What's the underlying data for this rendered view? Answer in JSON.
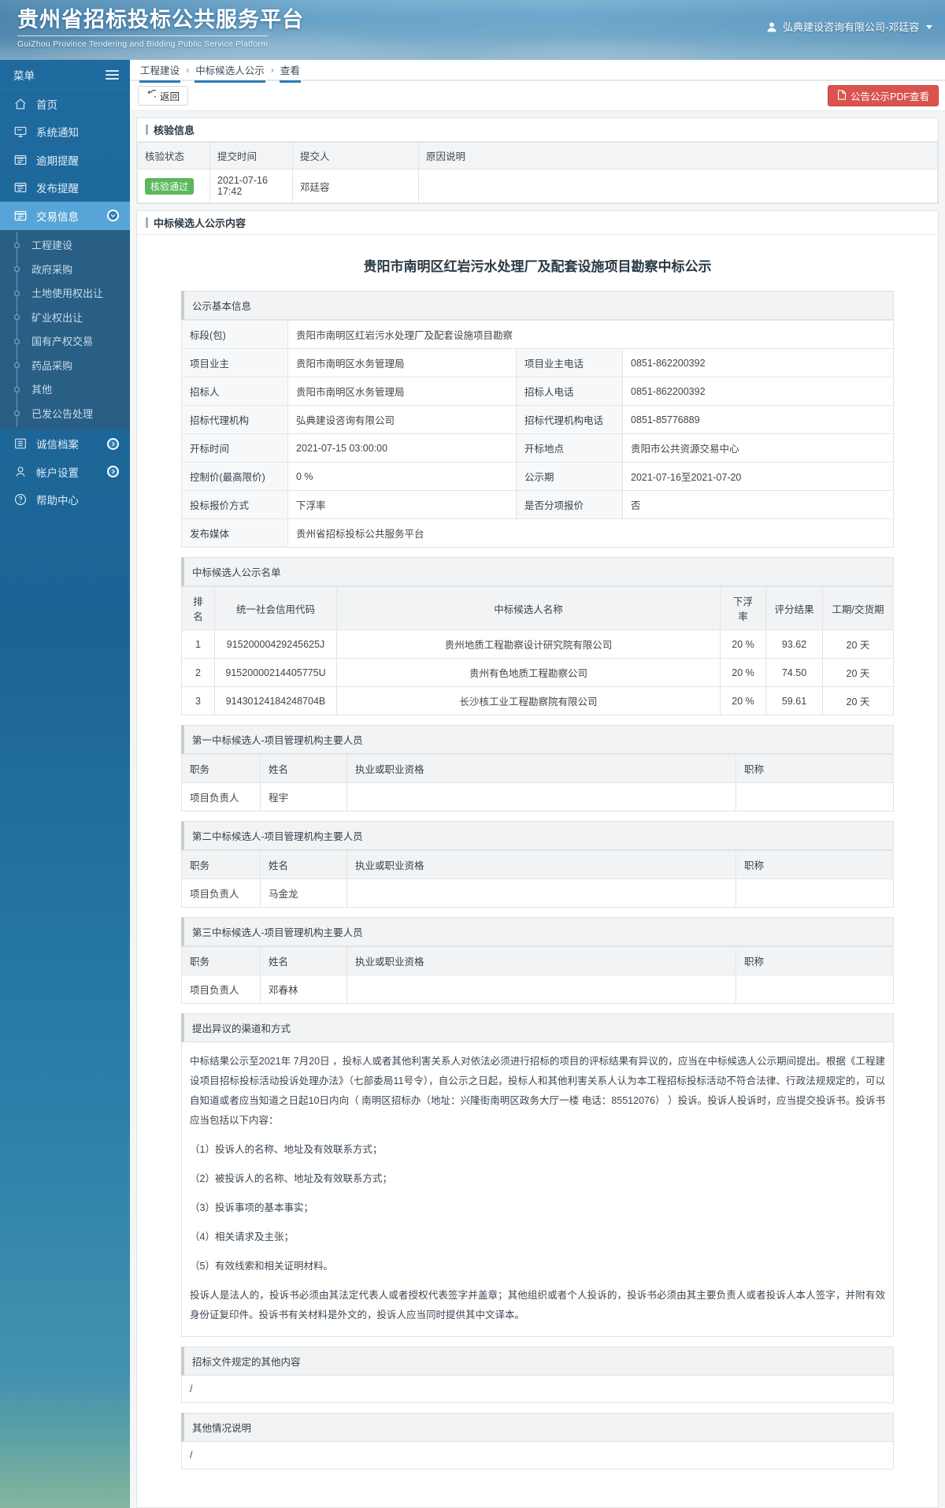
{
  "header": {
    "title_cn": "贵州省招标投标公共服务平台",
    "title_en": "GuiZhou Province Tendering and Bidding Public Service Platform",
    "user": "弘典建设咨询有限公司-邓廷容"
  },
  "sidebar": {
    "menu_label": "菜单",
    "items": [
      {
        "label": "首页",
        "icon": "home-icon",
        "active": false,
        "badge": ""
      },
      {
        "label": "系统通知",
        "icon": "monitor-icon",
        "active": false,
        "badge": ""
      },
      {
        "label": "逾期提醒",
        "icon": "list-box-icon",
        "active": false,
        "badge": ""
      },
      {
        "label": "发布提醒",
        "icon": "list-box-icon",
        "active": false,
        "badge": ""
      },
      {
        "label": "交易信息",
        "icon": "list-box-icon",
        "active": true,
        "badge": "chevron-down-icon"
      },
      {
        "label": "诚信档案",
        "icon": "list-lines-icon",
        "active": false,
        "badge": "chevron-right-icon"
      },
      {
        "label": "帐户设置",
        "icon": "user-icon",
        "active": false,
        "badge": "chevron-right-icon"
      },
      {
        "label": "帮助中心",
        "icon": "question-icon",
        "active": false,
        "badge": ""
      }
    ],
    "submenu": [
      "工程建设",
      "政府采购",
      "土地使用权出让",
      "矿业权出让",
      "国有产权交易",
      "药品采购",
      "其他",
      "已发公告处理"
    ]
  },
  "breadcrumb": {
    "items": [
      "工程建设",
      "中标候选人公示",
      "查看"
    ],
    "separator": "›"
  },
  "toolbar": {
    "back_label": "返回",
    "pdf_label": "公告公示PDF查看"
  },
  "verify_panel": {
    "title": "核验信息",
    "columns": [
      "核验状态",
      "提交时间",
      "提交人",
      "原因说明"
    ],
    "row": {
      "status": "核验通过",
      "submit_time": "2021-07-16 17:42",
      "submitter": "邓廷容",
      "reason": ""
    }
  },
  "content_panel": {
    "title": "中标候选人公示内容"
  },
  "doc": {
    "title": "贵阳市南明区红岩污水处理厂及配套设施项目勘察中标公示",
    "basic_info": {
      "section_title": "公示基本信息",
      "rows": [
        {
          "k": "标段(包)",
          "v": "贵阳市南明区红岩污水处理厂及配套设施项目勘察",
          "full": true
        },
        {
          "k": "项目业主",
          "v": "贵阳市南明区水务管理局",
          "k2": "项目业主电话",
          "v2": "0851-862200392"
        },
        {
          "k": "招标人",
          "v": "贵阳市南明区水务管理局",
          "k2": "招标人电话",
          "v2": "0851-862200392"
        },
        {
          "k": "招标代理机构",
          "v": "弘典建设咨询有限公司",
          "k2": "招标代理机构电话",
          "v2": "0851-85776889"
        },
        {
          "k": "开标时间",
          "v": "2021-07-15 03:00:00",
          "k2": "开标地点",
          "v2": "贵阳市公共资源交易中心"
        },
        {
          "k": "控制价(最高限价)",
          "v": "0 %",
          "k2": "公示期",
          "v2": "2021-07-16至2021-07-20"
        },
        {
          "k": "投标报价方式",
          "v": "下浮率",
          "k2": "是否分项报价",
          "v2": "否"
        },
        {
          "k": "发布媒体",
          "v": "贵州省招标投标公共服务平台",
          "full": true
        }
      ]
    },
    "candidates": {
      "section_title": "中标候选人公示名单",
      "columns": [
        "排名",
        "统一社会信用代码",
        "中标候选人名称",
        "下浮率",
        "评分结果",
        "工期/交货期"
      ],
      "rows": [
        [
          "1",
          "91520000429245625J",
          "贵州地质工程勘察设计研究院有限公司",
          "20 %",
          "93.62",
          "20 天"
        ],
        [
          "2",
          "91520000214405775U",
          "贵州有色地质工程勘察公司",
          "20 %",
          "74.50",
          "20 天"
        ],
        [
          "3",
          "91430124184248704B",
          "长沙核工业工程勘察院有限公司",
          "20 %",
          "59.61",
          "20 天"
        ]
      ]
    },
    "personnel": {
      "columns": [
        "职务",
        "姓名",
        "执业或职业资格",
        "职称"
      ],
      "groups": [
        {
          "section_title": "第一中标候选人-项目管理机构主要人员",
          "rows": [
            [
              "项目负责人",
              "程宇",
              "",
              ""
            ]
          ]
        },
        {
          "section_title": "第二中标候选人-项目管理机构主要人员",
          "rows": [
            [
              "项目负责人",
              "马金龙",
              "",
              ""
            ]
          ]
        },
        {
          "section_title": "第三中标候选人-项目管理机构主要人员",
          "rows": [
            [
              "项目负责人",
              "邓春林",
              "",
              ""
            ]
          ]
        }
      ]
    },
    "objection": {
      "section_title": "提出异议的渠道和方式",
      "paragraphs": [
        "中标结果公示至2021年 7月20日 ，投标人或者其他利害关系人对依法必须进行招标的项目的评标结果有异议的，应当在中标候选人公示期间提出。根据《工程建设项目招标投标活动投诉处理办法》（七部委局11号令），自公示之日起，投标人和其他利害关系人认为本工程招标投标活动不符合法律、行政法规规定的，可以自知道或者应当知道之日起10日内向（ 南明区招标办（地址：兴隆街南明区政务大厅一楼 电话：85512076） ）投诉。投诉人投诉时，应当提交投诉书。投诉书应当包括以下内容：",
        "（1）投诉人的名称、地址及有效联系方式；",
        "（2）被投诉人的名称、地址及有效联系方式；",
        "（3）投诉事项的基本事实；",
        "（4）相关请求及主张；",
        "（5）有效线索和相关证明材料。",
        "投诉人是法人的，投诉书必须由其法定代表人或者授权代表签字并盖章；其他组织或者个人投诉的，投诉书必须由其主要负责人或者投诉人本人签字，并附有效身份证复印件。投诉书有关材料是外文的，投诉人应当同时提供其中文译本。"
      ]
    },
    "other_doc": {
      "section_title": "招标文件规定的其他内容",
      "value": "/"
    },
    "other_note": {
      "section_title": "其他情况说明",
      "value": "/"
    }
  }
}
